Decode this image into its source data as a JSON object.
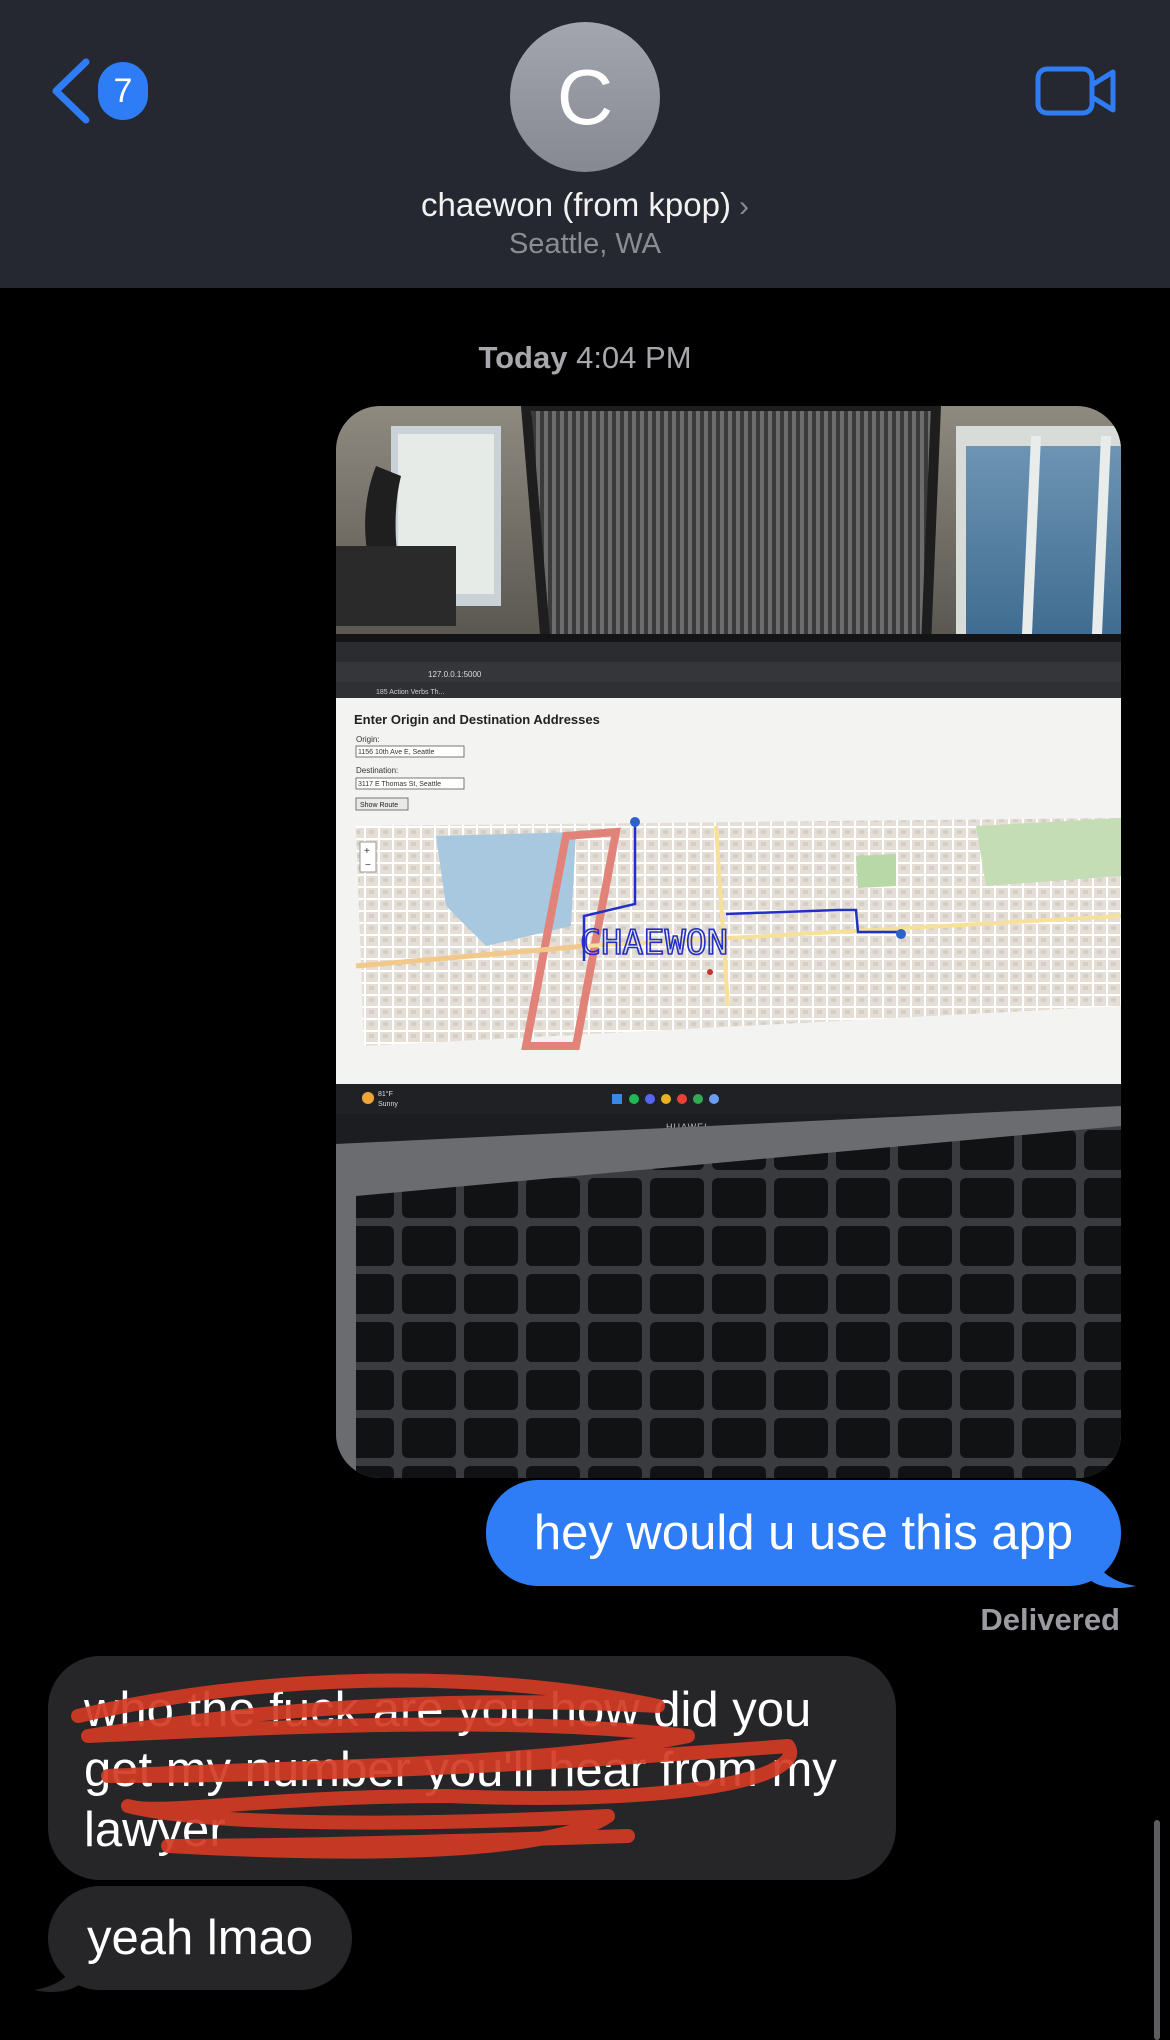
{
  "header": {
    "back_badge": "7",
    "avatar_initial": "C",
    "contact_name": "chaewon (from kpop)",
    "location": "Seattle, WA",
    "back_icon": "chevron-left-icon",
    "video_icon": "video-camera-icon"
  },
  "thread": {
    "timestamp_day": "Today",
    "timestamp_time": "4:04 PM",
    "photo": {
      "browser_url": "127.0.0.1:5000",
      "bookmark": "185 Action Verbs Th...",
      "form_heading": "Enter Origin and Destination Addresses",
      "origin_label": "Origin:",
      "origin_value": "1156 10th Ave E, Seattle",
      "destination_label": "Destination:",
      "destination_value": "3117 E Thomas St, Seattle",
      "show_route_label": "Show Route",
      "route_text": "CHAEWON",
      "weather_temp": "81°F",
      "weather_desc": "Sunny",
      "laptop_brand": "HUAWEI"
    },
    "sent_message": "hey would u use this app",
    "delivered_label": "Delivered",
    "received_1": "who the fuck are you how did you get my number you'll hear from my lawyer",
    "received_2": "yeah lmao"
  },
  "colors": {
    "header_bg": "#252830",
    "accent_blue": "#2e7cf6",
    "received_bubble": "#262629",
    "scribble_red": "#d13a24"
  }
}
